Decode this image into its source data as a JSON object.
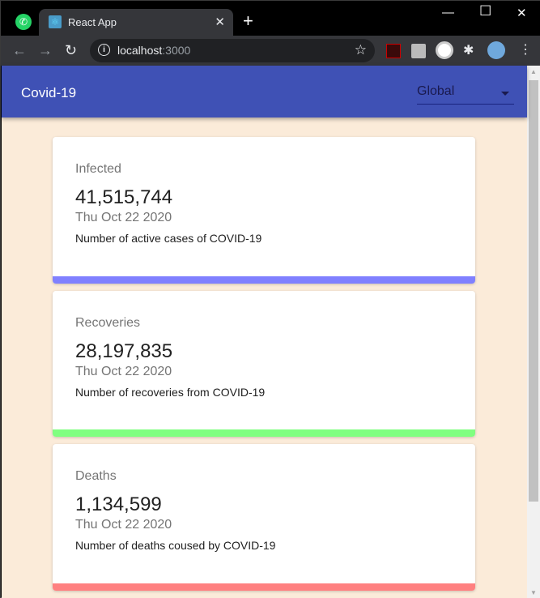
{
  "browser": {
    "tab_title": "React App",
    "url_host": "localhost",
    "url_port": ":3000"
  },
  "app": {
    "title": "Covid-19",
    "country_select": "Global"
  },
  "cards": [
    {
      "label": "Infected",
      "value": "41,515,744",
      "date": "Thu Oct 22 2020",
      "description": "Number of active cases of COVID-19",
      "color": "#8080ff"
    },
    {
      "label": "Recoveries",
      "value": "28,197,835",
      "date": "Thu Oct 22 2020",
      "description": "Number of recoveries from COVID-19",
      "color": "#80ff80"
    },
    {
      "label": "Deaths",
      "value": "1,134,599",
      "date": "Thu Oct 22 2020",
      "description": "Number of deaths coused by COVID-19",
      "color": "#ff8080"
    }
  ]
}
